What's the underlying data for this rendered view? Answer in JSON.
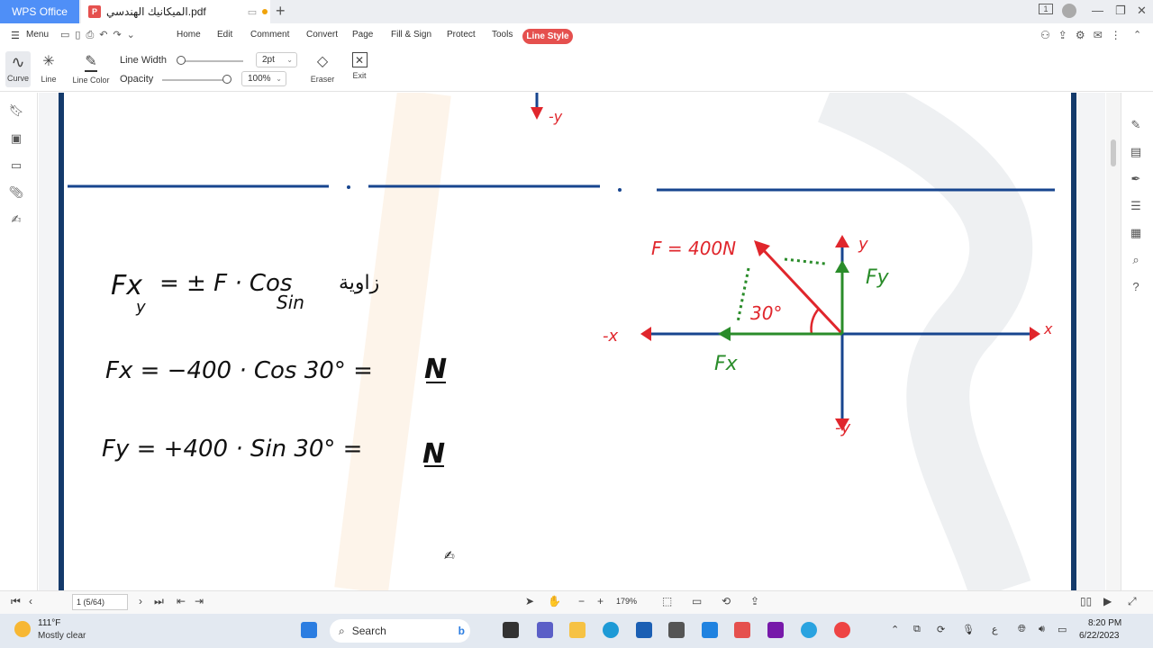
{
  "titlebar": {
    "app_tab": "WPS Office",
    "doc_tab": "الميكانيك الهندسي.pdf",
    "new_tab": "+",
    "badge_count": "1"
  },
  "menu": {
    "menu_label": "Menu",
    "tabs": [
      "Home",
      "Edit",
      "Comment",
      "Convert",
      "Page",
      "Fill & Sign",
      "Protect",
      "Tools"
    ],
    "active_tab": "Line Style"
  },
  "toolbar": {
    "curve": "Curve",
    "line": "Line",
    "line_color": "Line Color",
    "line_width_label": "Line Width",
    "line_width_value": "2pt",
    "opacity_label": "Opacity",
    "opacity_value": "100%",
    "opacity_level": 1.0,
    "eraser": "Eraser",
    "exit": "Exit"
  },
  "statusbar": {
    "page_indicator": "1 (5/64)",
    "zoom": "179%"
  },
  "taskbar": {
    "weather_temp": "111°F",
    "weather_desc": "Mostly clear",
    "search_placeholder": "Search",
    "time": "8:20 PM",
    "date": "6/22/2023",
    "lang": "ع"
  },
  "document": {
    "eq1_lhs": "Fx",
    "eq1_sub": "y",
    "eq1_rhs": "= ± F · Cos",
    "eq1_sin": "Sin",
    "eq1_arabic": "زاوية",
    "eq2": "Fx = −400 · Cos 30° =",
    "eq2_unit": "N",
    "eq3": "Fy = +400 · Sin 30° =",
    "eq3_unit": "N",
    "diagram": {
      "force_label": "F = 400N",
      "angle_label": "30°",
      "pos_y": "y",
      "neg_y": "-y",
      "pos_x": "x",
      "neg_x": "-x",
      "fy_label": "Fy",
      "fx_label": "Fx",
      "top_label": "-y"
    }
  },
  "colors": {
    "accent_red": "#e5504e",
    "wps_blue": "#4f8ff7",
    "page_border": "#143a6b",
    "ink_red": "#e0262c",
    "ink_green": "#2a8c2a",
    "ink_blue": "#17458f"
  }
}
